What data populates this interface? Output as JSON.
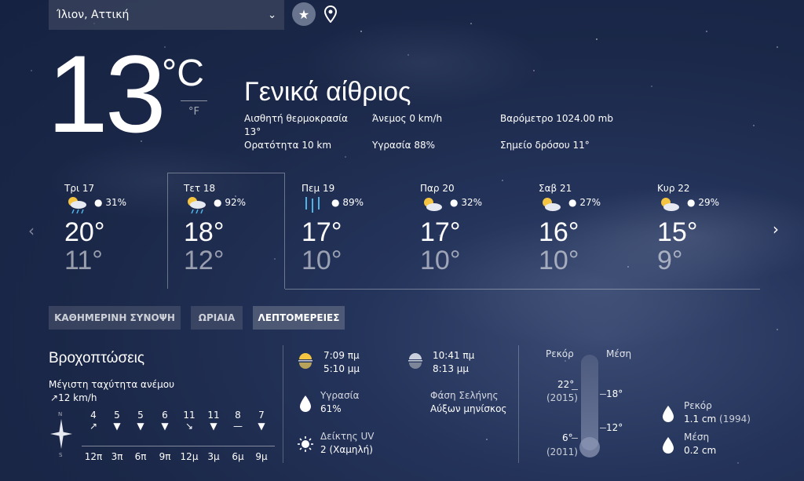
{
  "location": {
    "name": "Ίλιον, Αττική"
  },
  "current": {
    "temp": "13",
    "unit_c": "°C",
    "unit_f": "°F",
    "condition": "Γενικά αίθριος",
    "feels_like_label": "Αισθητή θερμοκρασία",
    "feels_like_value": "13°",
    "wind": "Άνεμος 0 km/h",
    "pressure": "Βαρόμετρο 1024.00 mb",
    "visibility": "Ορατότητα 10 km",
    "humidity": "Υγρασία 88%",
    "dew_point": "Σημείο δρόσου 11°"
  },
  "forecast": [
    {
      "day": "Τρι 17",
      "icon": "partly-cloudy-rain-icon",
      "precip": "31%",
      "high": "20°",
      "low": "11°"
    },
    {
      "day": "Τετ 18",
      "icon": "partly-cloudy-rain-icon",
      "precip": "92%",
      "high": "18°",
      "low": "12°"
    },
    {
      "day": "Πεμ 19",
      "icon": "rain-icon",
      "precip": "89%",
      "high": "17°",
      "low": "10°"
    },
    {
      "day": "Παρ 20",
      "icon": "partly-cloudy-icon",
      "precip": "32%",
      "high": "17°",
      "low": "10°"
    },
    {
      "day": "Σαβ 21",
      "icon": "partly-cloudy-icon",
      "precip": "27%",
      "high": "16°",
      "low": "10°"
    },
    {
      "day": "Κυρ 22",
      "icon": "partly-cloudy-icon",
      "precip": "29%",
      "high": "15°",
      "low": "9°"
    }
  ],
  "tabs": [
    "ΚΑΘΗΜΕΡΙΝΗ ΣΥΝΟΨΗ",
    "ΩΡΙΑΙΑ",
    "ΛΕΠΤΟΜΕΡΕΙΕΣ"
  ],
  "details": {
    "title": "Βροχοπτώσεις",
    "max_wind_label": "Μέγιστη ταχύτητα ανέμου",
    "max_wind_value": "12 km/h",
    "compass_n": "N",
    "compass_s": "S",
    "wind_speeds": [
      "4",
      "5",
      "5",
      "6",
      "11",
      "11",
      "8",
      "7"
    ],
    "wind_hours": [
      "12π",
      "3π",
      "6π",
      "9π",
      "12μ",
      "3μ",
      "6μ",
      "9μ"
    ],
    "sunrise": "7:09 πμ",
    "sunset": "5:10 μμ",
    "moonrise": "10:41 πμ",
    "moonset": "8:13 μμ",
    "humidity_label": "Υγρασία",
    "humidity_value": "61%",
    "moon_phase_label": "Φάση Σελήνης",
    "moon_phase_value": "Αύξων μηνίσκος",
    "uv_label": "Δείκτης UV",
    "uv_value": "2 (Χαμηλή)",
    "record_label": "Ρεκόρ",
    "avg_label": "Μέση",
    "record_high": "22°",
    "record_high_year": "(2015)",
    "record_low": "6°",
    "record_low_year": "(2011)",
    "avg_high": "18°",
    "avg_low": "12°",
    "precip_record_label": "Ρεκόρ",
    "precip_record_value": "1.1 cm",
    "precip_record_year": "(1994)",
    "precip_avg_label": "Μέση",
    "precip_avg_value": "0.2 cm"
  },
  "colors": {
    "accent_rain": "#4fb3e8",
    "sun": "#f5c542"
  }
}
